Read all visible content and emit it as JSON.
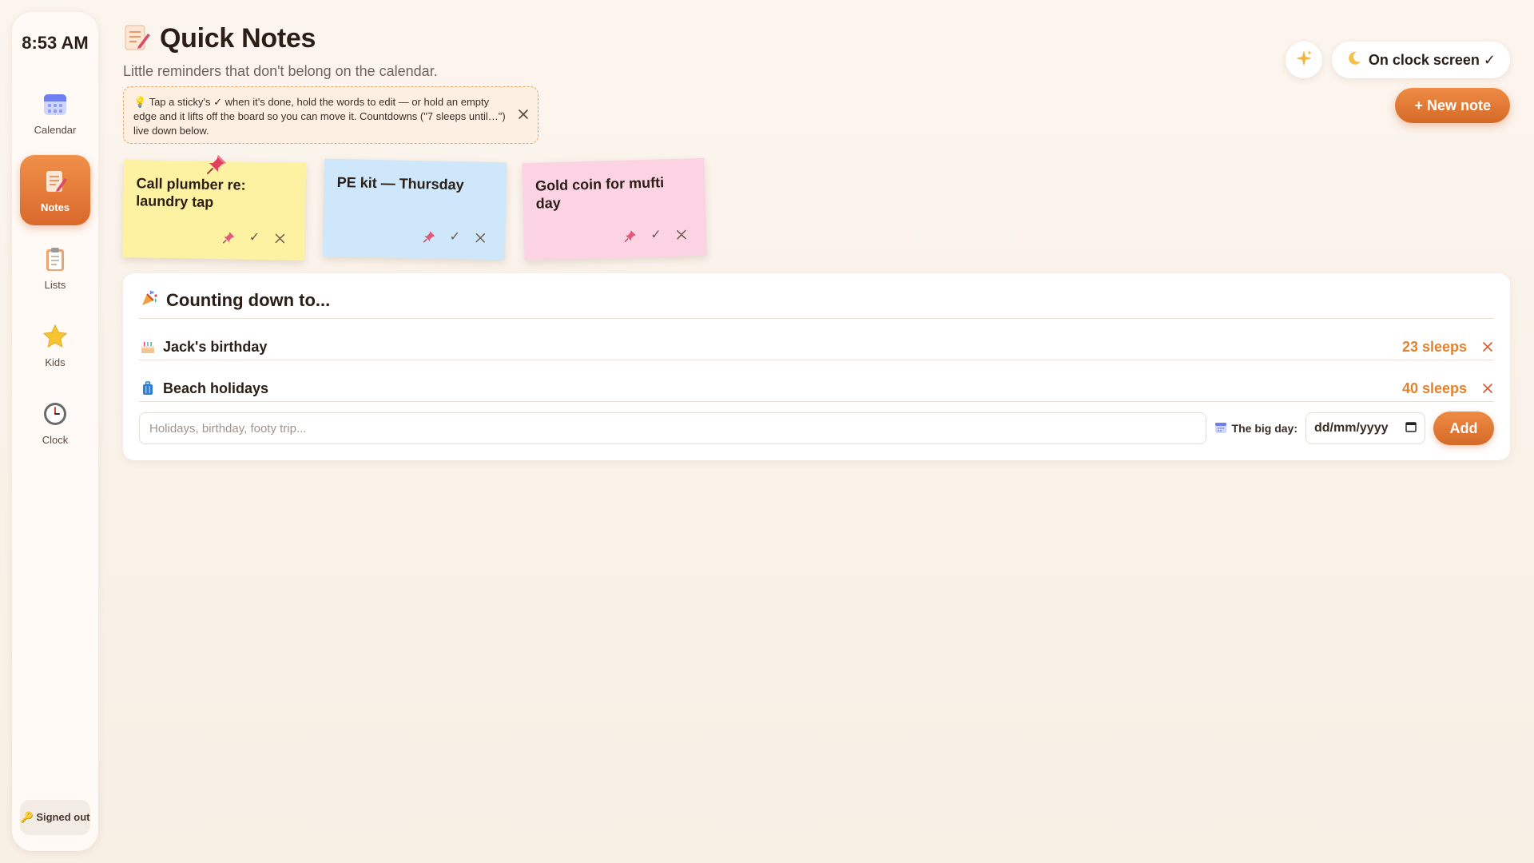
{
  "sidebar": {
    "time": "8:53 AM",
    "items": [
      {
        "label": "Calendar",
        "icon": "calendar-icon"
      },
      {
        "label": "Notes",
        "icon": "notes-icon",
        "active": true
      },
      {
        "label": "Lists",
        "icon": "clipboard-icon"
      },
      {
        "label": "Kids",
        "icon": "star-icon"
      },
      {
        "label": "Clock",
        "icon": "clock-icon"
      }
    ],
    "signed_status": "Signed out",
    "signed_icon": "key-icon"
  },
  "header": {
    "title": "Quick Notes",
    "title_icon": "memo-icon",
    "subtitle": "Little reminders that don't belong on the calendar."
  },
  "tip": {
    "icon": "lightbulb-icon",
    "text": "Tap a sticky's ✓ when it's done, hold the words to edit — or hold an empty edge and it lifts off the board so you can move it. Countdowns (\"7 sleeps until…\") live down below."
  },
  "toolbar": {
    "sparkle_icon": "sparkle-icon",
    "clock_screen_label": "On clock screen ✓",
    "clock_screen_icon": "moon-icon",
    "new_note_label": "+ New note"
  },
  "notes": [
    {
      "text": "Call plumber re: laundry tap",
      "color": "#fdf1a2",
      "pinned": true
    },
    {
      "text": "PE kit — Thursday",
      "color": "#cfe7fb",
      "pinned": false
    },
    {
      "text": "Gold coin for mufti day",
      "color": "#fcd3e3",
      "pinned": false
    }
  ],
  "countdown": {
    "title": "Counting down to...",
    "title_icon": "party-popper-icon",
    "items": [
      {
        "name": "Jack's birthday",
        "sleeps": "23 sleeps",
        "icon": "cake-icon"
      },
      {
        "name": "Beach holidays",
        "sleeps": "40 sleeps",
        "icon": "luggage-icon"
      }
    ],
    "input_placeholder": "Holidays, birthday, footy trip...",
    "big_day_label": "The big day:",
    "date_placeholder": "dd/mm/yyyy",
    "add_label": "Add"
  },
  "colors": {
    "accent": "#e07a35",
    "sleeps": "#e0832f",
    "background": "#fbf3ea"
  }
}
